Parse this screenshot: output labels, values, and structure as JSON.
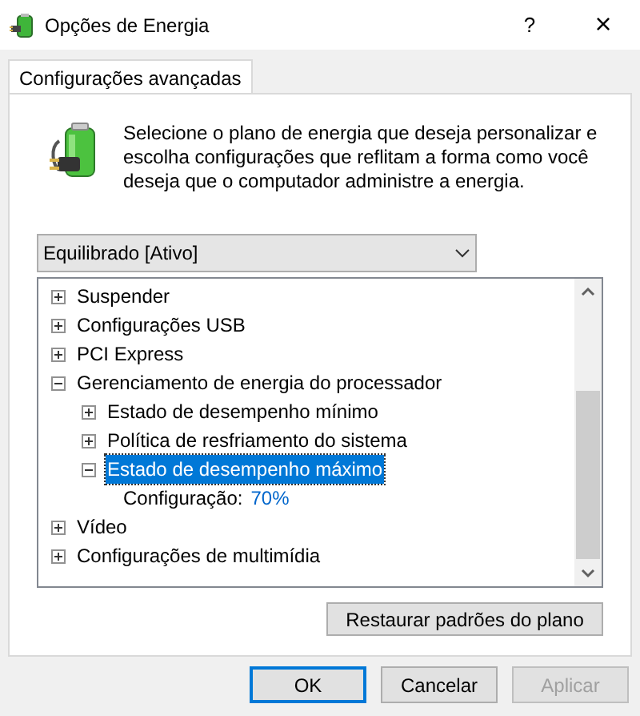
{
  "window": {
    "title": "Opções de Energia",
    "help": "?",
    "close": "×"
  },
  "tabs": [
    {
      "label": "Configurações avançadas",
      "selected": true
    }
  ],
  "description": "Selecione o plano de energia que deseja personalizar e escolha configurações que reflitam a forma como você deseja que o computador administre a energia.",
  "plan_select": {
    "value": "Equilibrado [Ativo]"
  },
  "tree": [
    {
      "kind": "group",
      "label": "Suspender",
      "expanded": false,
      "selected": false
    },
    {
      "kind": "group",
      "label": "Configurações USB",
      "expanded": false,
      "selected": false
    },
    {
      "kind": "group",
      "label": "PCI Express",
      "expanded": false,
      "selected": false
    },
    {
      "kind": "group",
      "label": "Gerenciamento de energia do processador",
      "expanded": true,
      "selected": false,
      "children": [
        {
          "kind": "group",
          "label": "Estado de desempenho mínimo",
          "expanded": false,
          "selected": false
        },
        {
          "kind": "group",
          "label": "Política de resfriamento do sistema",
          "expanded": false,
          "selected": false
        },
        {
          "kind": "group",
          "label": "Estado de desempenho máximo",
          "expanded": true,
          "selected": true,
          "children": [
            {
              "kind": "setting",
              "label": "Configuração:",
              "value": "70%"
            }
          ]
        }
      ]
    },
    {
      "kind": "group",
      "label": "Vídeo",
      "expanded": false,
      "selected": false
    },
    {
      "kind": "group",
      "label": "Configurações de multimídia",
      "expanded": false,
      "selected": false
    }
  ],
  "restore_button": "Restaurar padrões do plano",
  "buttons": [
    {
      "label": "OK",
      "kind": "default",
      "disabled": false
    },
    {
      "label": "Cancelar",
      "kind": "normal",
      "disabled": false
    },
    {
      "label": "Aplicar",
      "kind": "normal",
      "disabled": true
    }
  ]
}
